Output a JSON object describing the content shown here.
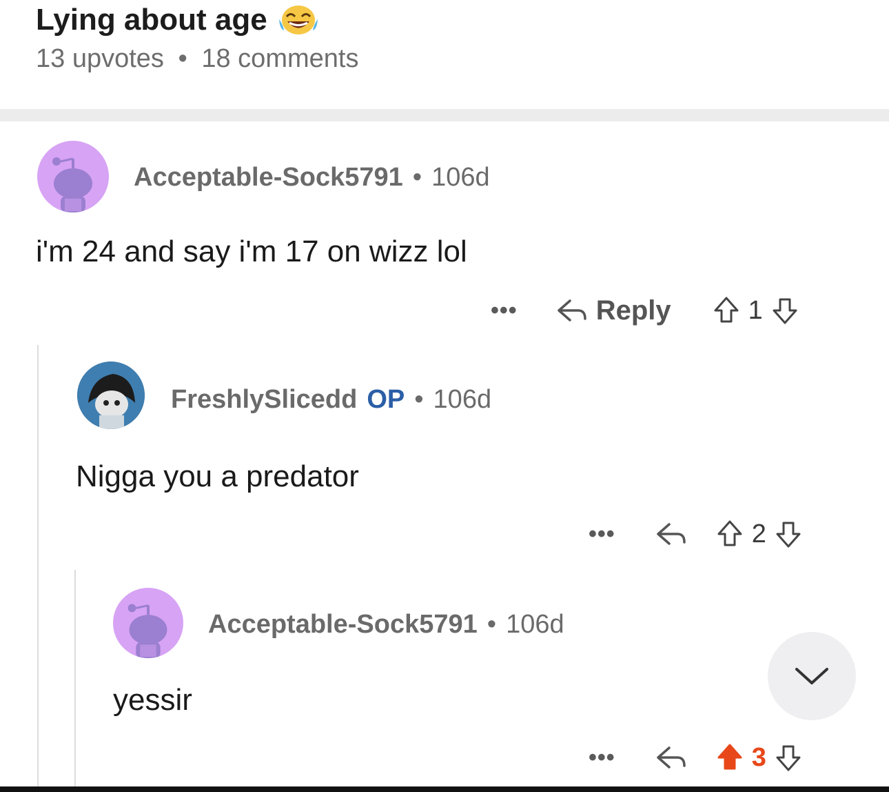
{
  "post": {
    "title": "Lying about age",
    "title_emoji": "tears-of-joy-emoji",
    "upvotes": "13 upvotes",
    "separator": "•",
    "comments": "18 comments"
  },
  "comments": [
    {
      "author": "Acceptable-Sock5791",
      "op_badge": "",
      "age": "106d",
      "body": "i'm 24 and say i'm 17 on wizz lol",
      "reply_label": "Reply",
      "score": "1",
      "upvoted": false
    },
    {
      "author": "FreshlySlicedd",
      "op_badge": "OP",
      "age": "106d",
      "body": "Nigga you a predator",
      "reply_label": "",
      "score": "2",
      "upvoted": false
    },
    {
      "author": "Acceptable-Sock5791",
      "op_badge": "",
      "age": "106d",
      "body": "yessir",
      "reply_label": "",
      "score": "3",
      "upvoted": true
    }
  ],
  "ui": {
    "dot": "•",
    "more_label": "•••"
  },
  "icons": {
    "reply": "reply-arrow-icon",
    "upvote": "upvote-arrow-icon",
    "downvote": "downvote-arrow-icon",
    "scroll": "chevron-down-icon"
  },
  "colors": {
    "avatar_purple": "#d7a3f5",
    "snoo_purple": "#9b7fd0",
    "op_blue": "#2b5ea7",
    "upvote_orange": "#e8471a",
    "muted_text": "#6a6a6a"
  }
}
